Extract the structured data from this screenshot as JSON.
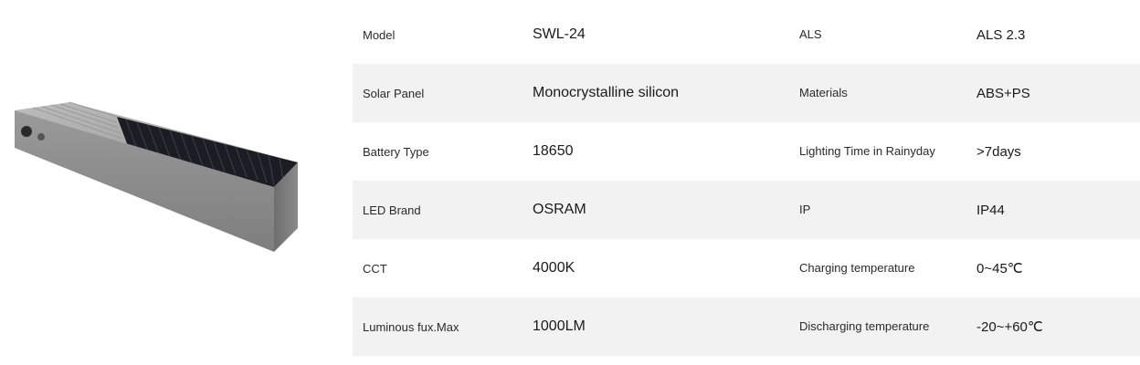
{
  "product_image": {
    "description_name": "solar-wall-light"
  },
  "specs": [
    {
      "label1": "Model",
      "value1": "SWL-24",
      "label2": "ALS",
      "value2": "ALS 2.3"
    },
    {
      "label1": "Solar Panel",
      "value1": "Monocrystalline silicon",
      "label2": "Materials",
      "value2": "ABS+PS"
    },
    {
      "label1": "Battery Type",
      "value1": "18650",
      "label2": "Lighting Time in Rainyday",
      "value2": ">7days"
    },
    {
      "label1": "LED Brand",
      "value1": "OSRAM",
      "label2": "IP",
      "value2": "IP44"
    },
    {
      "label1": "CCT",
      "value1": "4000K",
      "label2": "Charging temperature",
      "value2": "0~45℃"
    },
    {
      "label1": "Luminous fux.Max",
      "value1": "1000LM",
      "label2": "Discharging temperature",
      "value2": "-20~+60℃"
    }
  ],
  "colors": {
    "row_shade": "#f2f2f2",
    "panel": "#1a1c20",
    "body_front": "#8e8e8e",
    "body_top": "#a9a9a9"
  }
}
